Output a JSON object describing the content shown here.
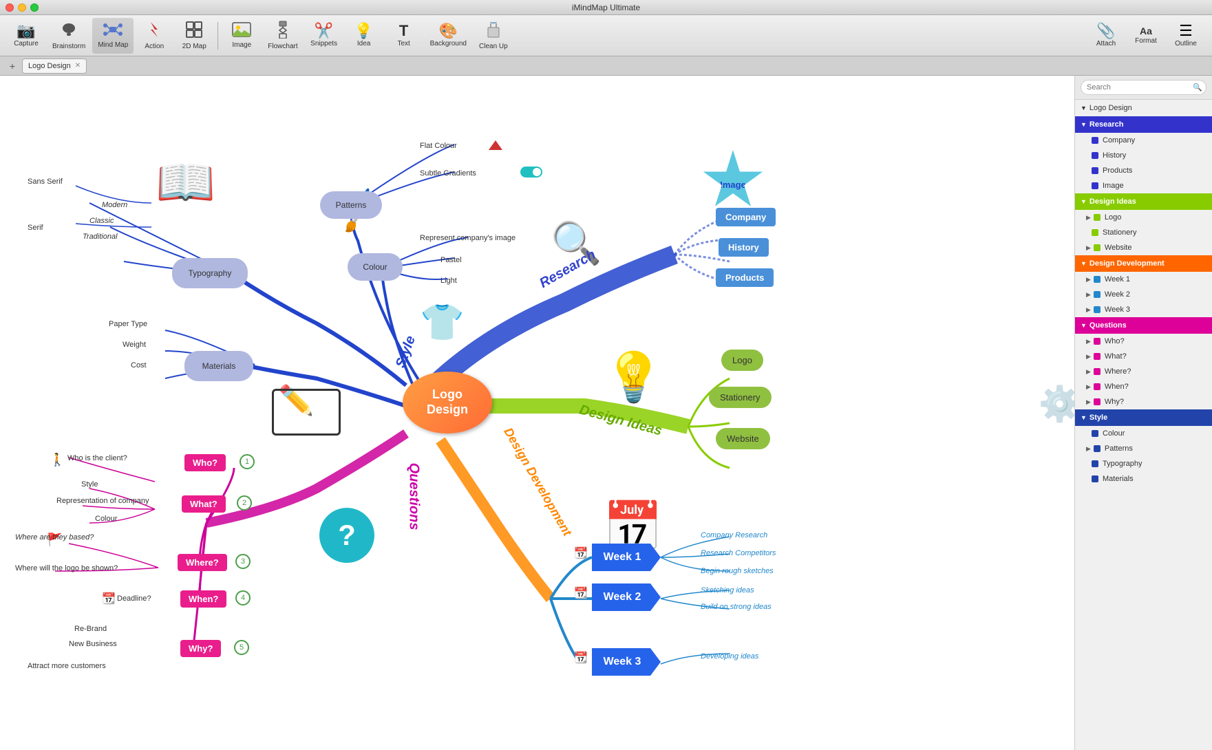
{
  "app": {
    "title": "iMindMap Ultimate",
    "tab_title": "Logo Design"
  },
  "toolbar": {
    "buttons": [
      {
        "id": "capture",
        "label": "Capture",
        "icon": "📷"
      },
      {
        "id": "brainstorm",
        "label": "Brainstorm",
        "icon": "🧠"
      },
      {
        "id": "mindmap",
        "label": "Mind Map",
        "icon": "🗺"
      },
      {
        "id": "action",
        "label": "Action",
        "icon": "⚡"
      },
      {
        "id": "2dmap",
        "label": "2D Map",
        "icon": "⊞"
      },
      {
        "id": "image",
        "label": "Image",
        "icon": "🖼"
      },
      {
        "id": "flowchart",
        "label": "Flowchart",
        "icon": "◈"
      },
      {
        "id": "snippets",
        "label": "Snippets",
        "icon": "✂"
      },
      {
        "id": "idea",
        "label": "Idea",
        "icon": "💡"
      },
      {
        "id": "text",
        "label": "Text",
        "icon": "T"
      },
      {
        "id": "background",
        "label": "Background",
        "icon": "🎨"
      },
      {
        "id": "cleanup",
        "label": "Clean Up",
        "icon": "🧹"
      },
      {
        "id": "attach",
        "label": "Attach",
        "icon": "📎"
      },
      {
        "id": "format",
        "label": "Format",
        "icon": "Aa"
      },
      {
        "id": "outline",
        "label": "Outline",
        "icon": "☰"
      }
    ]
  },
  "mindmap": {
    "center": {
      "label": "Logo\nDesign"
    },
    "branches": {
      "typography": {
        "label": "Typography",
        "subbranches": [
          "Sans Serif",
          "Serif"
        ],
        "leaves": [
          "Modern",
          "Classic",
          "Traditional"
        ]
      },
      "materials": {
        "label": "Materials",
        "leaves": [
          "Paper Type",
          "Weight",
          "Cost"
        ]
      },
      "patterns": {
        "label": "Patterns",
        "leaves": [
          "Flat Colour",
          "Subtle Gradients"
        ]
      },
      "colour": {
        "label": "Colour",
        "leaves": [
          "Represent company's image",
          "Pastel",
          "Light"
        ]
      },
      "research": {
        "label": "Research",
        "subbranches": [
          "Company",
          "History",
          "Products",
          "Image"
        ]
      },
      "design_ideas": {
        "label": "Design Ideas",
        "subbranches": [
          "Logo",
          "Stationery",
          "Website"
        ]
      },
      "design_development": {
        "label": "Design Development",
        "weeks": [
          {
            "label": "Week 1",
            "tasks": [
              "Company Research",
              "Research Competitors",
              "Begin rough sketches"
            ]
          },
          {
            "label": "Week 2",
            "tasks": [
              "Sketching ideas",
              "Build on strong ideas"
            ]
          },
          {
            "label": "Week 3",
            "tasks": [
              "Developing ideas"
            ]
          }
        ]
      },
      "questions": {
        "label": "Questions",
        "items": [
          {
            "label": "Who?",
            "num": "1",
            "leaves": [
              "Who is the client?"
            ]
          },
          {
            "label": "What?",
            "num": "2",
            "leaves": [
              "Style",
              "Representation of company",
              "Colour"
            ]
          },
          {
            "label": "Where?",
            "num": "3",
            "leaves": [
              "Where are they based?",
              "Where will the logo be shown?"
            ]
          },
          {
            "label": "When?",
            "num": "4",
            "leaves": [
              "Deadline?"
            ]
          },
          {
            "label": "Why?",
            "num": "5",
            "leaves": [
              "Re-Brand",
              "New Business",
              "Attract more customers"
            ]
          }
        ]
      }
    }
  },
  "sidebar": {
    "search_placeholder": "Search",
    "tree_title": "Logo Design",
    "sections": [
      {
        "id": "research",
        "label": "Research",
        "color": "#3333cc",
        "expanded": true,
        "items": [
          {
            "label": "Company",
            "color": "#3333cc"
          },
          {
            "label": "History",
            "color": "#3333cc"
          },
          {
            "label": "Products",
            "color": "#3333cc"
          },
          {
            "label": "Image",
            "color": "#3333cc"
          }
        ]
      },
      {
        "id": "design_ideas",
        "label": "Design Ideas",
        "color": "#88cc00",
        "expanded": true,
        "items": [
          {
            "label": "Logo",
            "color": "#88cc00",
            "has_arrow": true
          },
          {
            "label": "Stationery",
            "color": "#88cc00"
          },
          {
            "label": "Website",
            "color": "#88cc00",
            "has_arrow": true
          }
        ]
      },
      {
        "id": "design_development",
        "label": "Design Development",
        "color": "#ff6600",
        "expanded": true,
        "items": [
          {
            "label": "Week 1",
            "color": "#2288cc",
            "has_arrow": true
          },
          {
            "label": "Week 2",
            "color": "#2288cc",
            "has_arrow": true
          },
          {
            "label": "Week 3",
            "color": "#2288cc",
            "has_arrow": true
          }
        ]
      },
      {
        "id": "questions",
        "label": "Questions",
        "color": "#dd0099",
        "expanded": true,
        "items": [
          {
            "label": "Who?",
            "color": "#dd0099",
            "has_arrow": true
          },
          {
            "label": "What?",
            "color": "#dd0099",
            "has_arrow": true
          },
          {
            "label": "Where?",
            "color": "#dd0099",
            "has_arrow": true
          },
          {
            "label": "When?",
            "color": "#dd0099",
            "has_arrow": true
          },
          {
            "label": "Why?",
            "color": "#dd0099",
            "has_arrow": true
          }
        ]
      },
      {
        "id": "style",
        "label": "Style",
        "color": "#2244aa",
        "expanded": true,
        "items": [
          {
            "label": "Colour",
            "color": "#2244aa"
          },
          {
            "label": "Patterns",
            "color": "#2244aa",
            "has_arrow": true
          },
          {
            "label": "Typography",
            "color": "#2244aa"
          },
          {
            "label": "Materials",
            "color": "#2244aa"
          }
        ]
      }
    ]
  }
}
